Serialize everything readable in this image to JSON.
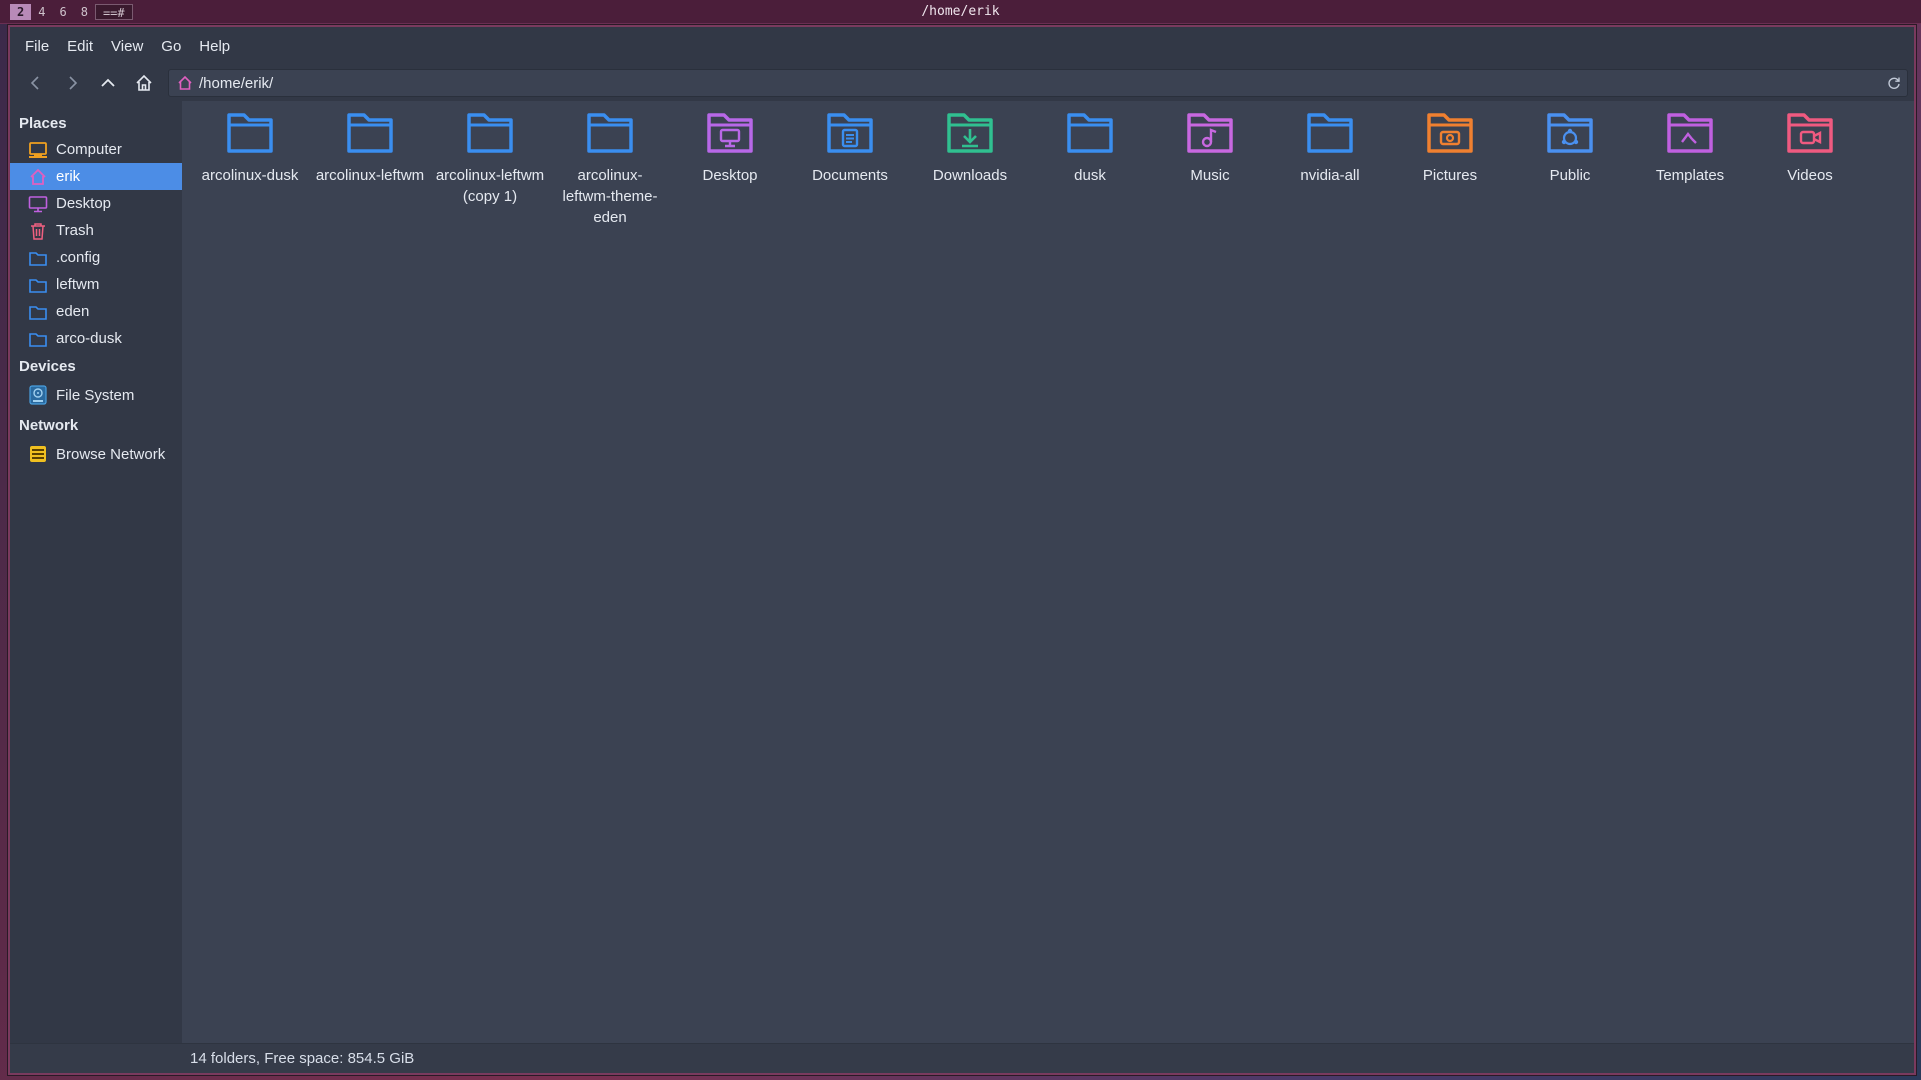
{
  "wm": {
    "tags": [
      "2",
      "4",
      "6",
      "8"
    ],
    "layout": "==#",
    "title": "/home/erik"
  },
  "menubar": {
    "items": [
      "File",
      "Edit",
      "View",
      "Go",
      "Help"
    ]
  },
  "toolbar": {
    "back_icon": "back-arrow-icon",
    "forward_icon": "forward-arrow-icon",
    "up_icon": "up-arrow-icon",
    "home_icon": "home-icon",
    "location": "/home/erik/",
    "reload_icon": "reload-icon"
  },
  "sidebar": {
    "places_heading": "Places",
    "places": [
      {
        "label": "Computer",
        "icon": "computer-icon",
        "color": "#f0a020"
      },
      {
        "label": "erik",
        "icon": "home-icon",
        "color": "#e060c0",
        "selected": true
      },
      {
        "label": "Desktop",
        "icon": "desktop-icon",
        "color": "#c060e0"
      },
      {
        "label": "Trash",
        "icon": "trash-icon",
        "color": "#f06080"
      },
      {
        "label": ".config",
        "icon": "folder-icon",
        "color": "#3a8ef0"
      },
      {
        "label": "leftwm",
        "icon": "folder-icon",
        "color": "#3a8ef0"
      },
      {
        "label": "eden",
        "icon": "folder-icon",
        "color": "#3a8ef0"
      },
      {
        "label": "arco-dusk",
        "icon": "folder-icon",
        "color": "#3a8ef0"
      }
    ],
    "devices_heading": "Devices",
    "devices": [
      {
        "label": "File System",
        "icon": "drive-icon",
        "color": "#4aa0e0"
      }
    ],
    "network_heading": "Network",
    "network": [
      {
        "label": "Browse Network",
        "icon": "network-icon",
        "color": "#f0c020"
      }
    ]
  },
  "files": [
    {
      "name": "arcolinux-dusk",
      "icon": "folder-icon",
      "color": "#3a8ef0"
    },
    {
      "name": "arcolinux-leftwm",
      "icon": "folder-icon",
      "color": "#3a8ef0"
    },
    {
      "name": "arcolinux-leftwm (copy 1)",
      "icon": "folder-icon",
      "color": "#3a8ef0"
    },
    {
      "name": "arcolinux-leftwm-theme-eden",
      "icon": "folder-icon",
      "color": "#3a8ef0"
    },
    {
      "name": "Desktop",
      "icon": "desktop-folder-icon",
      "color": "#b868e8"
    },
    {
      "name": "Documents",
      "icon": "documents-folder-icon",
      "color": "#3a8ef0"
    },
    {
      "name": "Downloads",
      "icon": "downloads-folder-icon",
      "color": "#30c090"
    },
    {
      "name": "dusk",
      "icon": "folder-icon",
      "color": "#3a8ef0"
    },
    {
      "name": "Music",
      "icon": "music-folder-icon",
      "color": "#c868e0"
    },
    {
      "name": "nvidia-all",
      "icon": "folder-icon",
      "color": "#3a8ef0"
    },
    {
      "name": "Pictures",
      "icon": "pictures-folder-icon",
      "color": "#f08030"
    },
    {
      "name": "Public",
      "icon": "public-folder-icon",
      "color": "#4a90f0"
    },
    {
      "name": "Templates",
      "icon": "templates-folder-icon",
      "color": "#c060e0"
    },
    {
      "name": "Videos",
      "icon": "videos-folder-icon",
      "color": "#f05a80"
    }
  ],
  "status": {
    "text": "14 folders, Free space: 854.5 GiB"
  }
}
